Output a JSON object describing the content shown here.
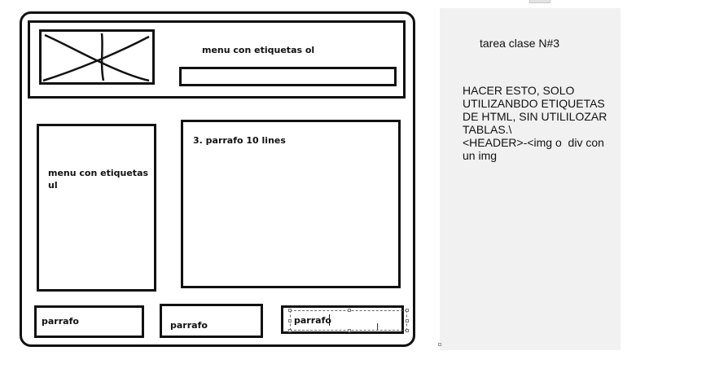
{
  "header_menu_label": "menu con etiquetas ol",
  "side_menu_label": "menu con etiquetas ul",
  "main_paragraph_label": "3. parrafo 10 lines",
  "footer_paragraphs": [
    "parrafo",
    "parrafo",
    "parrafo"
  ],
  "notes": {
    "title": "tarea clase N#3",
    "body": "HACER ESTO, SOLO UTILIZANBDO ETIQUETAS DE HTML, SIN UTILILOZAR TABLAS.\\\n<HEADER>-<img o  div con un img"
  }
}
